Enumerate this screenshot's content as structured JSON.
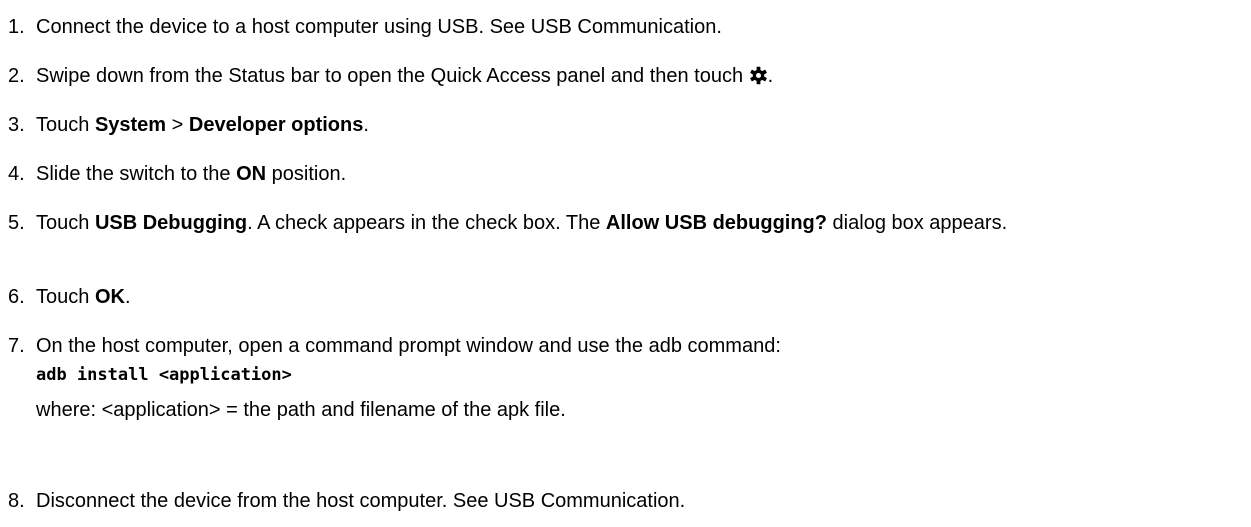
{
  "steps": [
    {
      "num": "1.",
      "text": "Connect the device to a host computer using USB. See USB Communication."
    },
    {
      "num": "2.",
      "pre": "Swipe down from the Status bar to open the Quick Access panel and then touch",
      "icon": "settings-gear-icon",
      "post": "."
    },
    {
      "num": "3.",
      "pre": "Touch ",
      "bold1": "System",
      "mid": " > ",
      "bold2": "Developer options",
      "post": "."
    },
    {
      "num": "4.",
      "pre": "Slide the switch to the ",
      "bold1": "ON",
      "post": " position."
    },
    {
      "num": "5.",
      "pre": "Touch ",
      "bold1": "USB Debugging",
      "mid": ". A check appears in the check box. The ",
      "bold2": "Allow USB debugging?",
      "post": " dialog box appears."
    },
    {
      "num": "6.",
      "pre": "Touch ",
      "bold1": "OK",
      "post": "."
    },
    {
      "num": "7.",
      "text": "On the host computer, open a command prompt window and use the adb command:",
      "code": "adb install <application>",
      "where": "where: <application> = the path and filename of the apk file."
    },
    {
      "num": "8.",
      "text": "Disconnect the device from the host computer. See USB Communication."
    }
  ]
}
